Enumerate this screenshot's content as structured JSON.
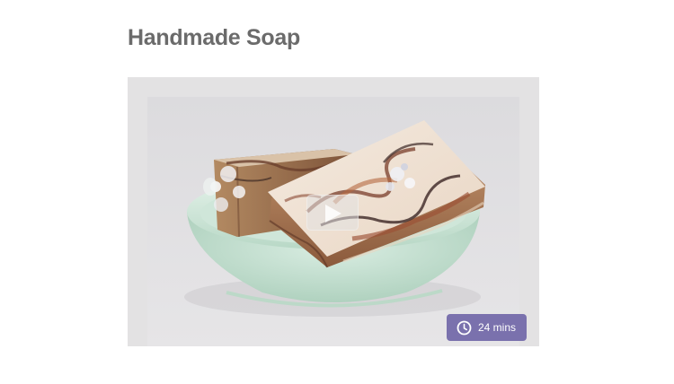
{
  "title": "Handmade Soap",
  "video": {
    "duration_label": "24 mins",
    "thumbnail": "handmade-soap-bars-in-dish",
    "icons": {
      "play": "play-icon",
      "clock": "clock-icon"
    }
  },
  "colors": {
    "title": "#6b6b6b",
    "badge": "#7a71ad",
    "card_background": "#e3e2e3",
    "dish": "#c6e0d2"
  }
}
